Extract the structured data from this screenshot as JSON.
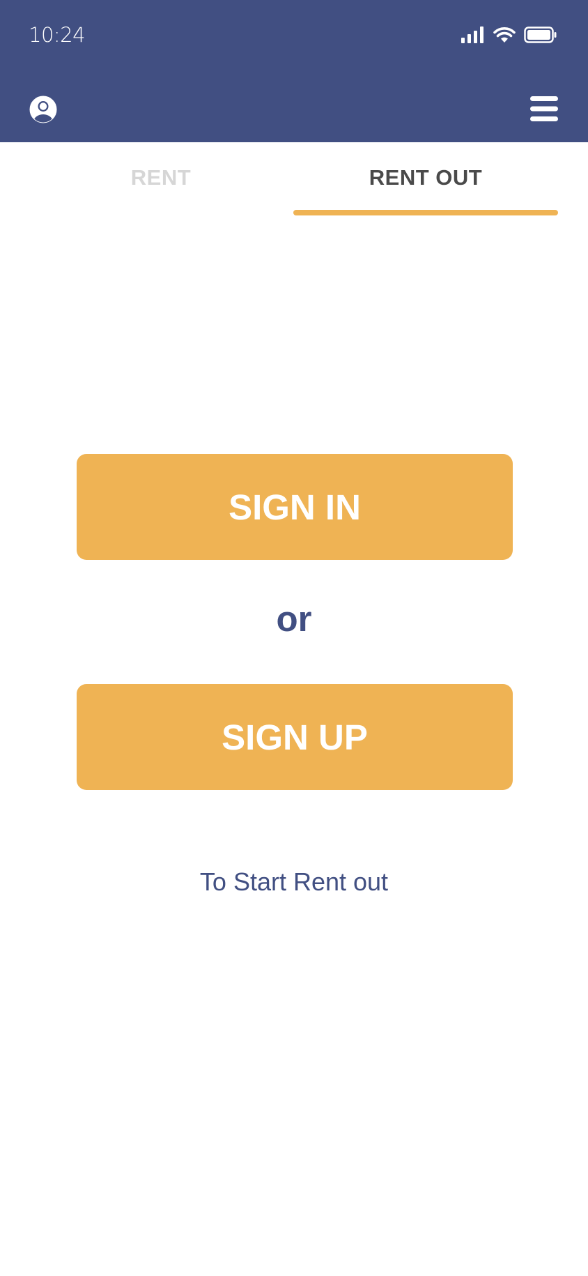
{
  "status_bar": {
    "time": "10:24",
    "icons": [
      "signal-icon",
      "wifi-icon",
      "battery-icon"
    ]
  },
  "app_bar": {
    "left_icon": "account-icon",
    "right_icon": "menu-icon"
  },
  "tabs": [
    {
      "label": "RENT",
      "active": false
    },
    {
      "label": "RENT OUT",
      "active": true
    }
  ],
  "auth": {
    "sign_in_label": "SIGN IN",
    "separator": "or",
    "sign_up_label": "SIGN UP",
    "caption": "To Start Rent out"
  },
  "colors": {
    "primary": "#414f82",
    "accent": "#efb354",
    "inactive_tab": "#d6d6d6",
    "active_tab": "#4a4a4a"
  }
}
